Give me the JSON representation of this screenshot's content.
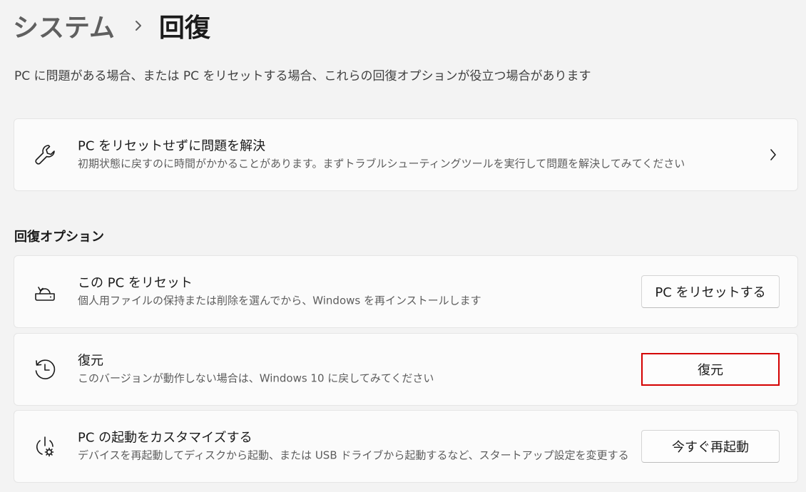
{
  "breadcrumb": {
    "parent": "システム",
    "current": "回復"
  },
  "intro": "PC に問題がある場合、または PC をリセットする場合、これらの回復オプションが役立つ場合があります",
  "troubleshoot_card": {
    "title": "PC をリセットせずに問題を解決",
    "description": "初期状態に戻すのに時間がかかることがあります。まずトラブルシューティングツールを実行して問題を解決してみてください",
    "icon": "wrench-icon"
  },
  "section_label": "回復オプション",
  "options": {
    "reset": {
      "title": "この PC をリセット",
      "description": "個人用ファイルの保持または削除を選んでから、Windows を再インストールします",
      "button": "PC をリセットする",
      "icon": "reset-pc-icon"
    },
    "goback": {
      "title": "復元",
      "description": "このバージョンが動作しない場合は、Windows 10 に戻してみてください",
      "button": "復元",
      "icon": "history-icon",
      "highlight_color": "#d40000"
    },
    "startup": {
      "title": "PC の起動をカスタマイズする",
      "description": "デバイスを再起動してディスクから起動、または USB ドライブから起動するなど、スタートアップ設定を変更する",
      "button": "今すぐ再起動",
      "icon": "power-settings-icon"
    }
  }
}
